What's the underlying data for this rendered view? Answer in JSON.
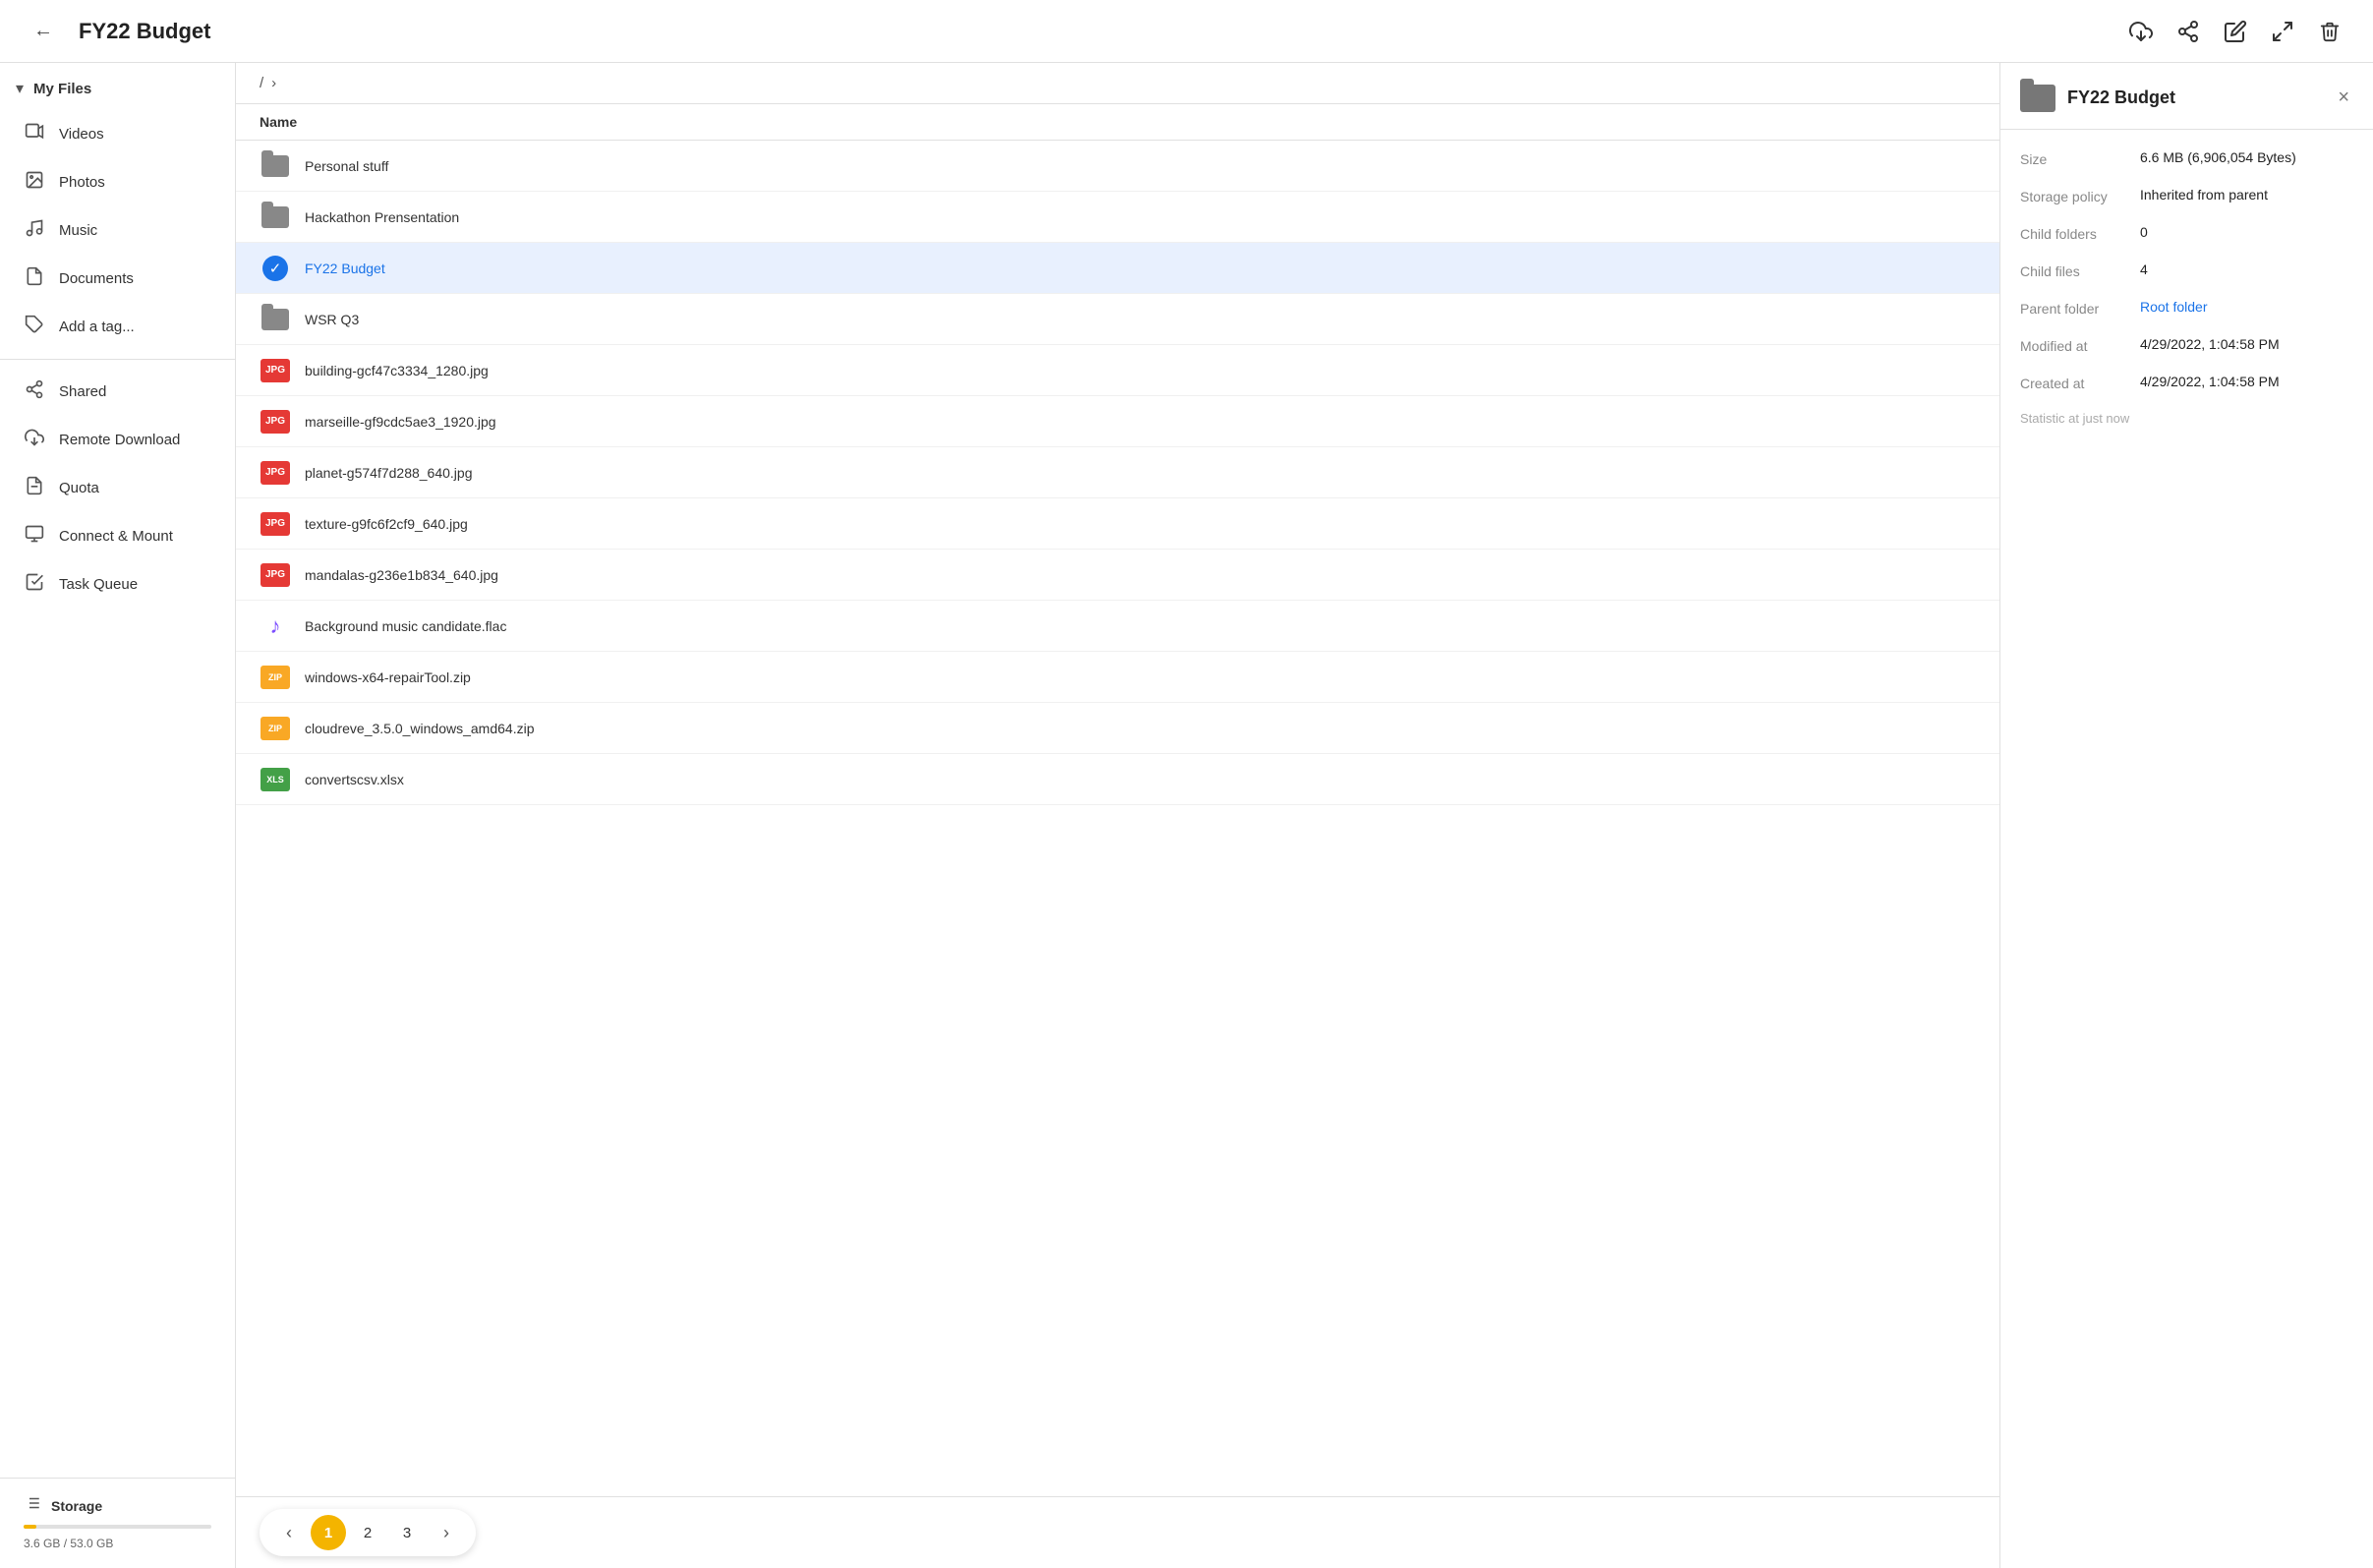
{
  "header": {
    "back_label": "←",
    "title": "FY22 Budget",
    "actions": {
      "download_tooltip": "Download",
      "share_tooltip": "Share",
      "edit_tooltip": "Edit",
      "export_tooltip": "Export",
      "delete_tooltip": "Delete"
    }
  },
  "sidebar": {
    "my_files_label": "My Files",
    "nav_items": [
      {
        "id": "videos",
        "label": "Videos",
        "icon": "🎬"
      },
      {
        "id": "photos",
        "label": "Photos",
        "icon": "🖼"
      },
      {
        "id": "music",
        "label": "Music",
        "icon": "🎵"
      },
      {
        "id": "documents",
        "label": "Documents",
        "icon": "📄"
      },
      {
        "id": "add-tag",
        "label": "Add a tag...",
        "icon": "🏷"
      }
    ],
    "more_items": [
      {
        "id": "shared",
        "label": "Shared",
        "icon": "share"
      },
      {
        "id": "remote-download",
        "label": "Remote Download",
        "icon": "cloud-download"
      },
      {
        "id": "quota",
        "label": "Quota",
        "icon": "quota"
      },
      {
        "id": "connect-mount",
        "label": "Connect & Mount",
        "icon": "monitor"
      },
      {
        "id": "task-queue",
        "label": "Task Queue",
        "icon": "task"
      }
    ],
    "storage": {
      "label": "Storage",
      "used": "3.6 GB",
      "total": "53.0 GB",
      "display": "3.6 GB / 53.0 GB",
      "percent": 6.8
    }
  },
  "breadcrumb": {
    "root": "/",
    "separator": "›"
  },
  "file_list": {
    "column_name": "Name",
    "files": [
      {
        "id": "personal-stuff",
        "name": "Personal stuff",
        "type": "folder",
        "selected": false
      },
      {
        "id": "hackathon",
        "name": "Hackathon Prensentation",
        "type": "folder",
        "selected": false
      },
      {
        "id": "fy22-budget",
        "name": "FY22 Budget",
        "type": "folder",
        "selected": true
      },
      {
        "id": "wsr-q3",
        "name": "WSR Q3",
        "type": "folder",
        "selected": false
      },
      {
        "id": "building-jpg",
        "name": "building-gcf47c3334_1280.jpg",
        "type": "image",
        "selected": false
      },
      {
        "id": "marseille-jpg",
        "name": "marseille-gf9cdc5ae3_1920.jpg",
        "type": "image",
        "selected": false
      },
      {
        "id": "planet-jpg",
        "name": "planet-g574f7d288_640.jpg",
        "type": "image",
        "selected": false
      },
      {
        "id": "texture-jpg",
        "name": "texture-g9fc6f2cf9_640.jpg",
        "type": "image",
        "selected": false
      },
      {
        "id": "mandalas-jpg",
        "name": "mandalas-g236e1b834_640.jpg",
        "type": "image",
        "selected": false
      },
      {
        "id": "background-flac",
        "name": "Background music candidate.flac",
        "type": "music",
        "selected": false
      },
      {
        "id": "windows-zip",
        "name": "windows-x64-repairTool.zip",
        "type": "zip",
        "selected": false
      },
      {
        "id": "cloudreve-zip",
        "name": "cloudreve_3.5.0_windows_amd64.zip",
        "type": "zip",
        "selected": false
      },
      {
        "id": "convertscsv-xlsx",
        "name": "convertscsv.xlsx",
        "type": "xls",
        "selected": false
      }
    ]
  },
  "pagination": {
    "prev_label": "‹",
    "next_label": "›",
    "pages": [
      "1",
      "2",
      "3"
    ],
    "active_page": "1"
  },
  "detail_panel": {
    "folder_name": "FY22 Budget",
    "close_label": "×",
    "rows": [
      {
        "label": "Size",
        "value": "6.6 MB (6,906,054 Bytes)",
        "type": "text"
      },
      {
        "label": "Storage policy",
        "value": "Inherited from parent",
        "type": "text"
      },
      {
        "label": "Child folders",
        "value": "0",
        "type": "text"
      },
      {
        "label": "Child files",
        "value": "4",
        "type": "text"
      },
      {
        "label": "Parent folder",
        "value": "Root folder",
        "type": "link"
      },
      {
        "label": "Modified at",
        "value": "4/29/2022, 1:04:58 PM",
        "type": "text"
      },
      {
        "label": "Created at",
        "value": "4/29/2022, 1:04:58 PM",
        "type": "text"
      }
    ],
    "stat": "Statistic at just now"
  }
}
